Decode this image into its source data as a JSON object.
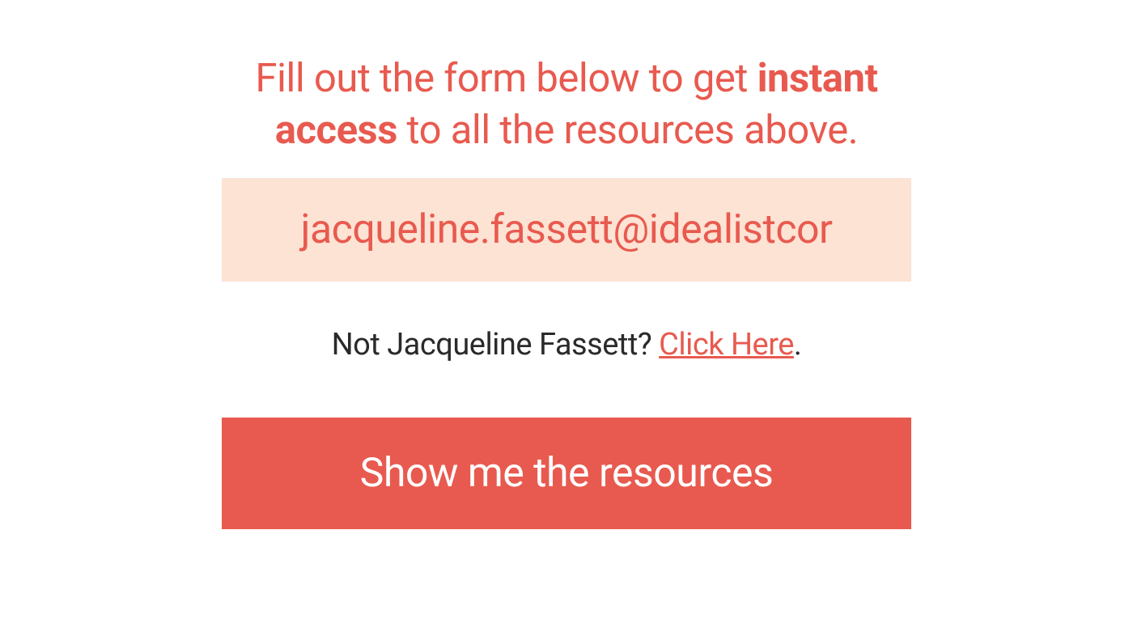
{
  "heading": {
    "part1": "Fill out the form below to get ",
    "bold": "instant access",
    "part2": " to all the resources above."
  },
  "email": {
    "value": "jacqueline.fassett@idealistcor"
  },
  "not_user": {
    "prefix": "Not Jacqueline Fassett? ",
    "link": "Click Here",
    "suffix": "."
  },
  "submit": {
    "label": "Show me the resources"
  },
  "colors": {
    "primary": "#e85a4f",
    "input_bg": "#fce3d4",
    "text_dark": "#2a2a2a"
  }
}
